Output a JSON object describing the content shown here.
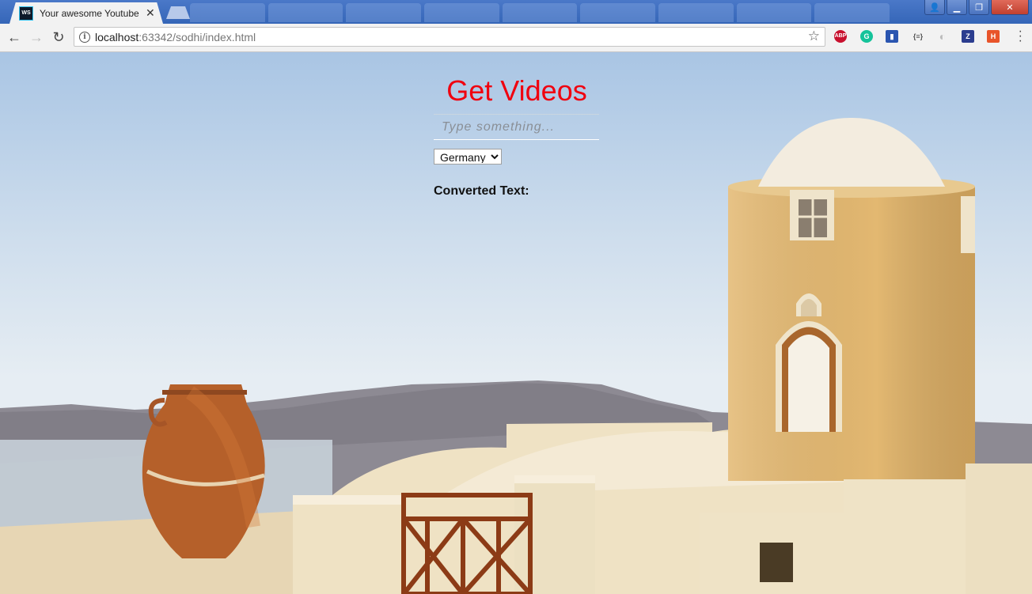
{
  "browser": {
    "tab_title": "Your awesome Youtube",
    "tab_favicon_text": "WS",
    "url_host": "localhost",
    "url_rest": ":63342/sodhi/index.html",
    "extensions": [
      "ABP",
      "G",
      "bookmark-icon",
      "{≡}",
      "shield-icon",
      "Z",
      "H"
    ]
  },
  "page": {
    "title": "Get Videos",
    "search_placeholder": "Type something...",
    "country_select": {
      "selected": "Germany",
      "options": [
        "Germany"
      ]
    },
    "converted_label": "Converted Text:",
    "colors": {
      "title": "#f0000f"
    }
  }
}
